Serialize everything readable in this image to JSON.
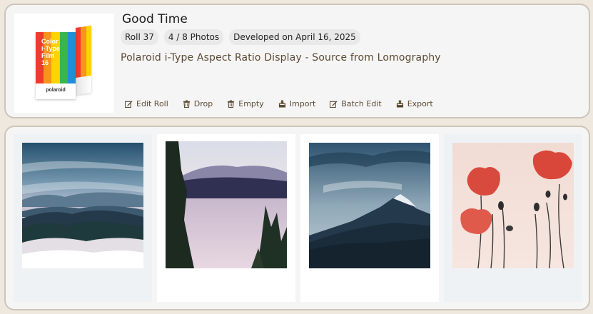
{
  "roll": {
    "title": "Good Time",
    "number": "Roll 37",
    "photo_count": "4 / 8 Photos",
    "developed": "Developed on April 16, 2025",
    "description": "Polaroid i-Type Aspect Ratio Display - Source from Lomography"
  },
  "film_box": {
    "line1": "Color",
    "line2": "i-Type",
    "line3": "Film",
    "count": "16",
    "brand": "polaroid",
    "stripe_colors": [
      "#ef3b2c",
      "#f7941d",
      "#ffd200",
      "#3ab54a",
      "#1e90d6"
    ]
  },
  "actions": [
    {
      "label": "Edit Roll",
      "icon": "edit-icon"
    },
    {
      "label": "Drop",
      "icon": "trash-icon"
    },
    {
      "label": "Empty",
      "icon": "trash-icon"
    },
    {
      "label": "Import",
      "icon": "import-icon"
    },
    {
      "label": "Batch Edit",
      "icon": "edit-icon"
    },
    {
      "label": "Export",
      "icon": "export-icon"
    }
  ],
  "photos": [
    {
      "subject": "misty-mountains"
    },
    {
      "subject": "mountain-lake"
    },
    {
      "subject": "cloudy-peak"
    },
    {
      "subject": "poppies"
    }
  ],
  "colors": {
    "background": "#eee8df",
    "panel": "#f5f5f5",
    "panel_border": "#cdc5b8",
    "accent_text": "#5d4a33"
  }
}
